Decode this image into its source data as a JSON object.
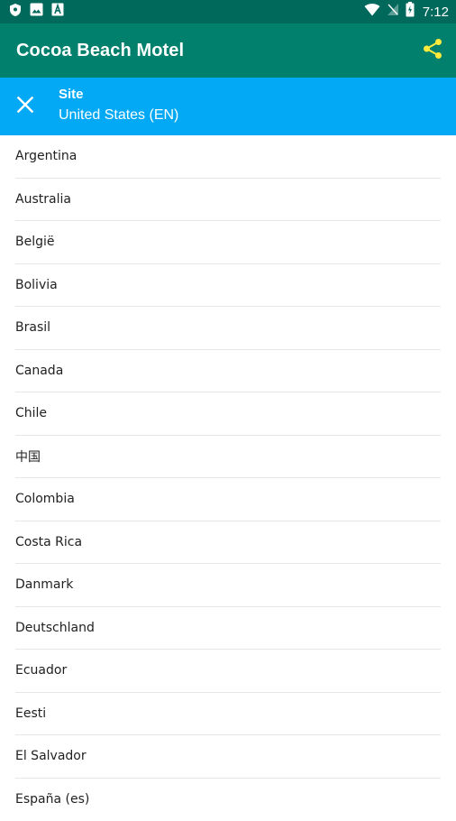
{
  "status_bar": {
    "time": "7:12",
    "left_icons": [
      "shield-icon",
      "image-icon",
      "text-a-icon"
    ],
    "right_icons": [
      "wifi-icon",
      "no-signal-icon",
      "battery-icon"
    ]
  },
  "app_bar": {
    "title": "Cocoa Beach Motel",
    "share_icon": "share-icon",
    "accent_color": "#ffeb3b"
  },
  "site_selector": {
    "label": "Site",
    "value": "United States (EN)",
    "close_icon": "close-icon"
  },
  "countries": [
    {
      "label": "Argentina"
    },
    {
      "label": "Australia"
    },
    {
      "label": "België"
    },
    {
      "label": "Bolivia"
    },
    {
      "label": "Brasil"
    },
    {
      "label": "Canada"
    },
    {
      "label": "Chile"
    },
    {
      "label": "中国"
    },
    {
      "label": "Colombia"
    },
    {
      "label": "Costa Rica"
    },
    {
      "label": "Danmark"
    },
    {
      "label": "Deutschland"
    },
    {
      "label": "Ecuador"
    },
    {
      "label": "Eesti"
    },
    {
      "label": "El Salvador"
    },
    {
      "label": "España (es)"
    }
  ],
  "colors": {
    "status_bar": "#00695c",
    "app_bar": "#00806d",
    "site_bar": "#03a9f4",
    "divider": "#e6e6e6"
  }
}
